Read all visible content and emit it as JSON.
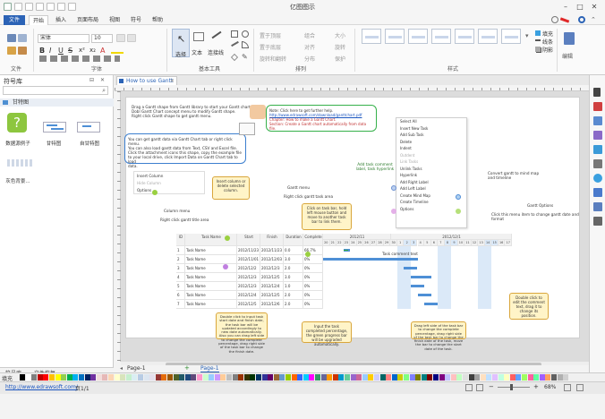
{
  "window": {
    "title": "亿图图示"
  },
  "menu": {
    "file": "文件",
    "items": [
      "开始",
      "插入",
      "页面布局",
      "视图",
      "符号",
      "帮助"
    ]
  },
  "ribbon": {
    "font_name": "宋体",
    "font_size": "10",
    "groups": [
      "文件",
      "字体",
      "基本工具",
      "排列",
      "样式",
      "编辑"
    ],
    "tools": {
      "select": "选择",
      "text": "文本",
      "connector": "连接线"
    },
    "arrange": [
      "置于顶层",
      "组合",
      "大小",
      "置于底层",
      "对齐",
      "旋转",
      "旋转和翻转",
      "分布",
      "保护"
    ],
    "fill": "填充",
    "line": "线条",
    "shadow": "阴影",
    "edit": "编辑"
  },
  "left_panel": {
    "title": "符号库",
    "library": "甘特图",
    "shapes": [
      "数据源例子",
      "甘特图",
      "自甘特图",
      "灰色背景..."
    ],
    "tabs": [
      "符号库",
      "文件恢复"
    ]
  },
  "document": {
    "tab": "How to use Gantt"
  },
  "canvas": {
    "intro": [
      "Drag a Gantt shape from Gantt library to start your Gantt chart.",
      "Dobl Gantt Chart concept menu to modify Gantt shape.",
      "Right click Gantt shape to get gantt menu."
    ],
    "data_box": [
      "You can get gantt data via Gantt Chart tab or right click menu.",
      "You can also load gantt data from Text, CSV and Excel file.",
      "Click the attachment icons this shape, copy the example file",
      "to your local drive, click Import Data on Gantt Chart tab to load",
      "data."
    ],
    "note": [
      "Note: Click here to get further help.",
      "http://www.edrawsoft.com/download/ganttchart.pdf",
      "Chapter: How to make a Gantt Chart.",
      "Section: Create a Gantt chart automatically from data file."
    ],
    "insert_menu": [
      "Insert Column",
      "Hide Column",
      "Options"
    ],
    "insert_callout": "Insert column or delete selected column.",
    "column_menu": "Column menu",
    "column_menu_sub": "Right click gantt title area",
    "gantt_menu": "Gantt menu",
    "gantt_menu_sub": "Right click gantt task area",
    "ctx_items": [
      "Select All",
      "Insert New Task",
      "Add Sub Task",
      "Delete",
      "Indent",
      "Outdent",
      "Link Tasks",
      "Unlink Tasks",
      "Hyperlink",
      "Add Right Label",
      "Add Left Label",
      "Create Mind Map",
      "Create Timeline",
      "Options"
    ],
    "add_comment": "Add task comment label, task hyperlink",
    "convert_mindmap": "Convert gantt to mind map and timeline",
    "gantt_options": "Gantt Options",
    "gantt_options_sub": "Click this menu item to change gantt date and format",
    "click_taskbar": "Click on task bar, hold left mouse button and move to another task bar to link them.",
    "dbl_click": "Double click to edit the comment text, drag it to change its position.",
    "task_comment": "Task comment text",
    "callout_dates": "Double click to input task start date and finish date, the task bar will be updated accordingly to new date automatically. Also you can drag left side to change the complete percentage, drag right side of the task bar to change the finish date.",
    "callout_percent": "Input the task completed percentage, the green progress bar will be upgraded automatically.",
    "callout_drag": "Drag left side of the task bar to change the complete percentage, drag right side of the task bar to change the finish date of the task, move the bar to change the start date of the task."
  },
  "gantt": {
    "headers": [
      "ID",
      "Task Name",
      "Start",
      "Finish",
      "Duration",
      "Complete"
    ],
    "month1": "2012/11",
    "month2": "2012/12/1",
    "days1": [
      "20",
      "21",
      "22",
      "23",
      "24",
      "25",
      "26",
      "27",
      "28",
      "29",
      "30"
    ],
    "days2": [
      "1",
      "2",
      "3",
      "4",
      "5",
      "6",
      "7",
      "8",
      "9",
      "10",
      "11",
      "12",
      "13",
      "14",
      "15",
      "16",
      "17"
    ],
    "rows": [
      {
        "id": "1",
        "name": "Task Name",
        "start": "2012/11/23",
        "finish": "2012/11/23",
        "dur": "0.0",
        "pct": "66.7%"
      },
      {
        "id": "2",
        "name": "Task Name",
        "start": "2012/11/01",
        "finish": "2012/12/03",
        "dur": "3.0",
        "pct": "0%"
      },
      {
        "id": "3",
        "name": "Task Name",
        "start": "2012/12/2",
        "finish": "2012/12/3",
        "dur": "2.0",
        "pct": "0%"
      },
      {
        "id": "4",
        "name": "Task Name",
        "start": "2012/12/3",
        "finish": "2012/12/5",
        "dur": "3.0",
        "pct": "0%"
      },
      {
        "id": "5",
        "name": "Task Name",
        "start": "2012/12/3",
        "finish": "2012/12/4",
        "dur": "1.0",
        "pct": "0%"
      },
      {
        "id": "6",
        "name": "Task Name",
        "start": "2012/12/4",
        "finish": "2012/12/5",
        "dur": "2.0",
        "pct": "0%"
      },
      {
        "id": "7",
        "name": "Task Name",
        "start": "2012/12/5",
        "finish": "2012/12/6",
        "dur": "2.0",
        "pct": "0%"
      }
    ]
  },
  "page_tabs": {
    "page": "Page-1",
    "active": "Page-1"
  },
  "status": {
    "url": "http://www.edrawsoft.com/",
    "page": "页1/1",
    "zoom": "68%",
    "fill_label": "填充"
  }
}
